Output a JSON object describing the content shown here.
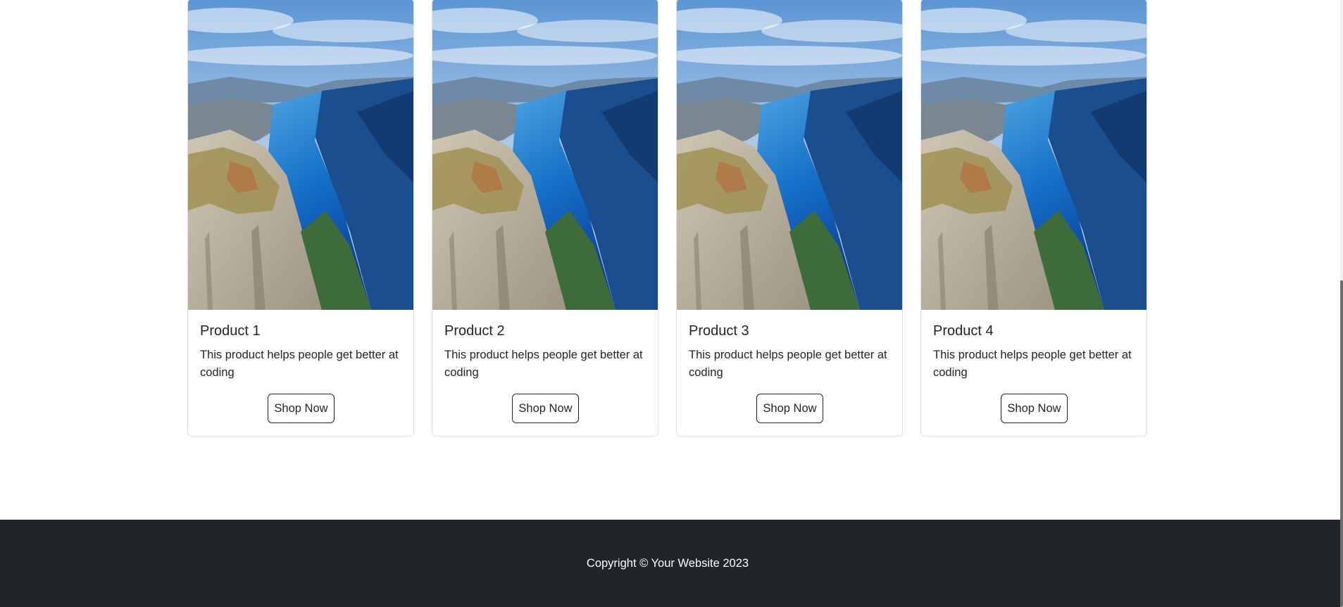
{
  "products": [
    {
      "title": "Product 1",
      "description": "This product helps people get better at coding",
      "button": "Shop Now",
      "image": "fjord-cliff-photo"
    },
    {
      "title": "Product 2",
      "description": "This product helps people get better at coding",
      "button": "Shop Now",
      "image": "fjord-cliff-photo"
    },
    {
      "title": "Product 3",
      "description": "This product helps people get better at coding",
      "button": "Shop Now",
      "image": "fjord-cliff-photo"
    },
    {
      "title": "Product 4",
      "description": "This product helps people get better at coding",
      "button": "Shop Now",
      "image": "fjord-cliff-photo"
    }
  ],
  "footer": {
    "copyright": "Copyright © Your Website 2023"
  },
  "colors": {
    "footer_bg": "#212529",
    "text": "#212529",
    "card_border": "#dee2e6"
  }
}
